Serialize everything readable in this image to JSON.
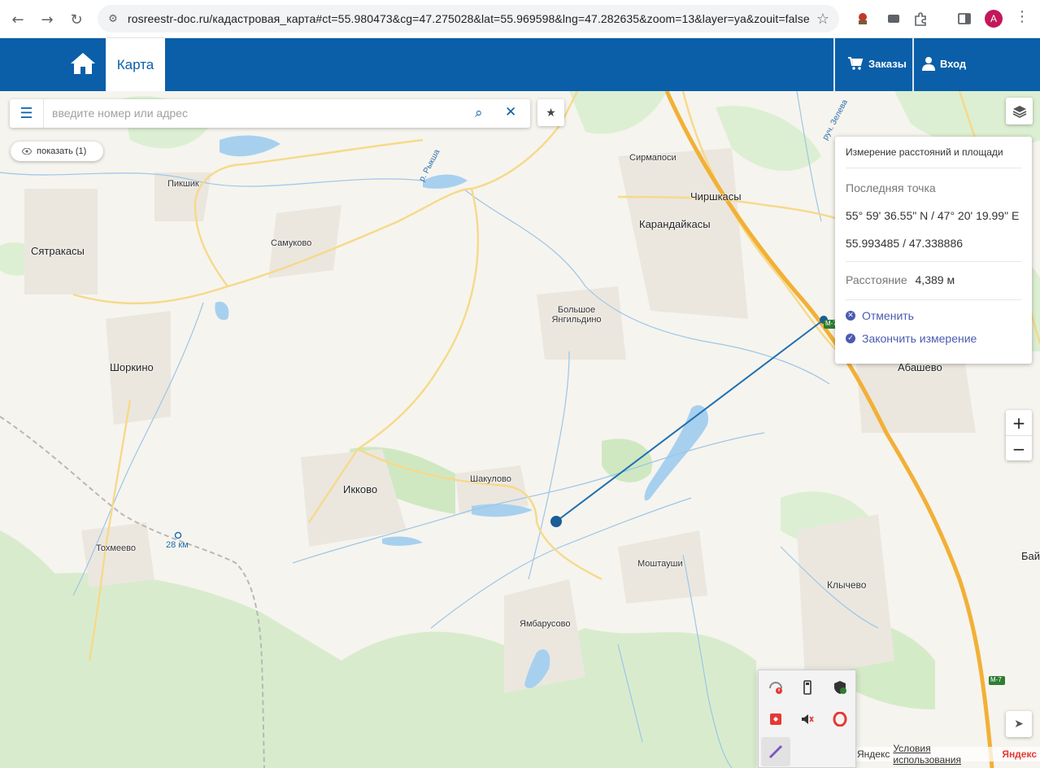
{
  "browser": {
    "url": "rosreestr-doc.ru/кадастровая_карта#ct=55.980473&cg=47.275028&lat=55.969598&lng=47.282635&zoom=13&layer=ya&zouit=false",
    "avatar_letter": "A"
  },
  "header": {
    "tab_label": "Карта",
    "orders_label": "Заказы",
    "login_label": "Вход",
    "brand_color": "#0a5fa8"
  },
  "search": {
    "placeholder": "введите номер или адрес"
  },
  "show_button": {
    "label": "показать (1)"
  },
  "measure_panel": {
    "title": "Измерение расстояний и площади",
    "last_point_label": "Последняя точка",
    "dms": "55° 59' 36.55\" N / 47° 20' 19.99\" E",
    "decimal": "55.993485 / 47.338886",
    "distance_label": "Расстояние",
    "distance_value": "4,389 м",
    "cancel_label": "Отменить",
    "finish_label": "Закончить измерение"
  },
  "map": {
    "places": [
      {
        "name": "Пикшик"
      },
      {
        "name": "Сятракасы"
      },
      {
        "name": "Самуково"
      },
      {
        "name": "Сирмапоси"
      },
      {
        "name": "Чиршкасы"
      },
      {
        "name": "Карандайкасы"
      },
      {
        "name": "Большое Янгильдино"
      },
      {
        "name": "Шоркино"
      },
      {
        "name": "Абашево"
      },
      {
        "name": "Икково"
      },
      {
        "name": "Шакулово"
      },
      {
        "name": "Тохмеево"
      },
      {
        "name": "Моштауши"
      },
      {
        "name": "Клычево"
      },
      {
        "name": "Ямбарусово"
      },
      {
        "name": "Бай"
      }
    ],
    "river_labels": [
      "р. Рыкша",
      "руч. Зелева"
    ],
    "road_labels": [
      "M-7",
      "M-7"
    ],
    "km_marker": "28 км"
  },
  "zoom": {
    "plus": "+",
    "minus": "−"
  },
  "copyright": {
    "prefix": "Яндекс",
    "terms": "Условия использования",
    "brand": "Яндекс"
  }
}
